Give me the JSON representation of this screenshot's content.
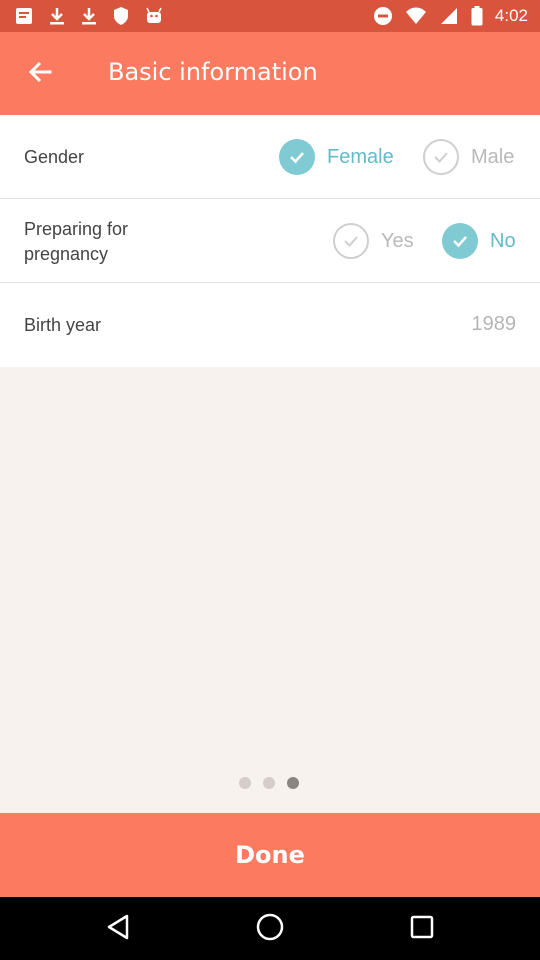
{
  "status_bar": {
    "time": "4:02",
    "left_icons": [
      "notification-icon",
      "download-icon",
      "download-icon",
      "shield-icon",
      "android-icon"
    ],
    "right_icons": [
      "do-not-disturb-icon",
      "wifi-icon",
      "signal-icon",
      "battery-icon"
    ]
  },
  "header": {
    "title": "Basic information",
    "back_icon": "arrow-left-icon"
  },
  "gender": {
    "label": "Gender",
    "options": [
      {
        "label": "Female",
        "selected": true
      },
      {
        "label": "Male",
        "selected": false
      }
    ]
  },
  "pregnancy": {
    "label_line1": "Preparing for",
    "label_line2": "pregnancy",
    "options": [
      {
        "label": "Yes",
        "selected": false
      },
      {
        "label": "No",
        "selected": true
      }
    ]
  },
  "birth_year": {
    "label": "Birth year",
    "value": "1989"
  },
  "pager": {
    "total": 3,
    "active_index": 2
  },
  "footer": {
    "done_label": "Done"
  },
  "colors": {
    "status_bar": "#d9543c",
    "accent": "#fb7a60",
    "selected": "#7fcad3",
    "background": "#f7f2ee"
  }
}
